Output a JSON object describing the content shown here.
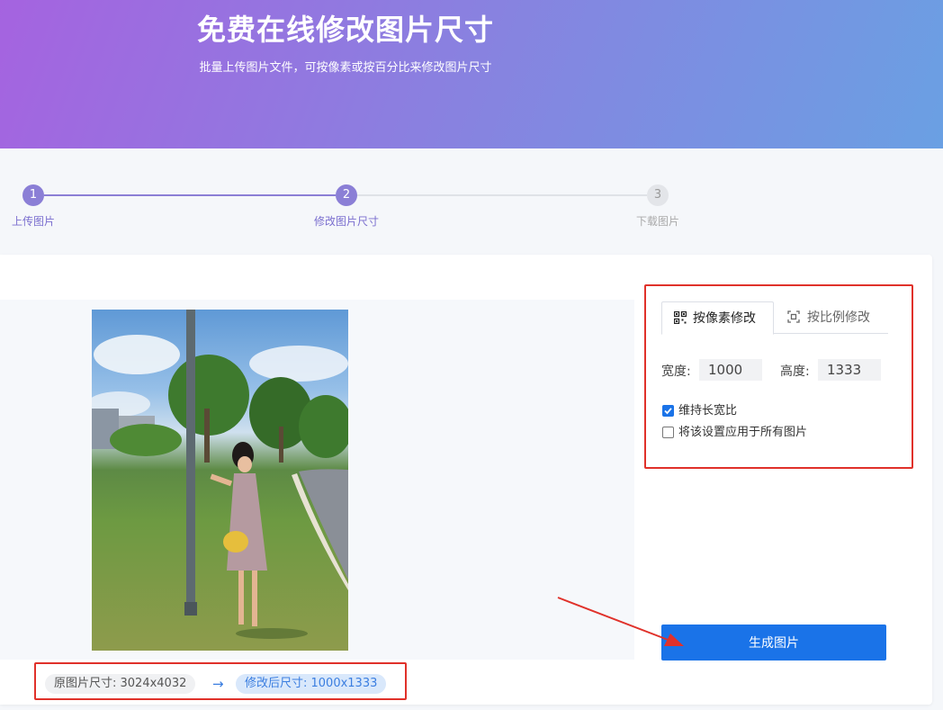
{
  "hero": {
    "title": "免费在线修改图片尺寸",
    "subtitle": "批量上传图片文件，可按像素或按百分比来修改图片尺寸"
  },
  "steps": [
    {
      "number": "1",
      "label": "上传图片",
      "state": "done"
    },
    {
      "number": "2",
      "label": "修改图片尺寸",
      "state": "active"
    },
    {
      "number": "3",
      "label": "下载图片",
      "state": "pending"
    }
  ],
  "settings": {
    "tab_pixel": "按像素修改",
    "tab_ratio": "按比例修改",
    "width_label": "宽度:",
    "width_value": "1000",
    "height_label": "高度:",
    "height_value": "1333",
    "keep_ratio_label": "维持长宽比",
    "keep_ratio_checked": true,
    "apply_all_label": "将该设置应用于所有图片",
    "apply_all_checked": false
  },
  "preview": {
    "original_size": "原图片尺寸: 3024x4032",
    "arrow": "→",
    "new_size": "修改后尺寸: 1000x1333"
  },
  "generate_button": "生成图片",
  "colors": {
    "accent": "#1a73e8",
    "step_active": "#8b7fd6",
    "step_pending": "#d5d8de",
    "annotation": "#e0312a"
  }
}
